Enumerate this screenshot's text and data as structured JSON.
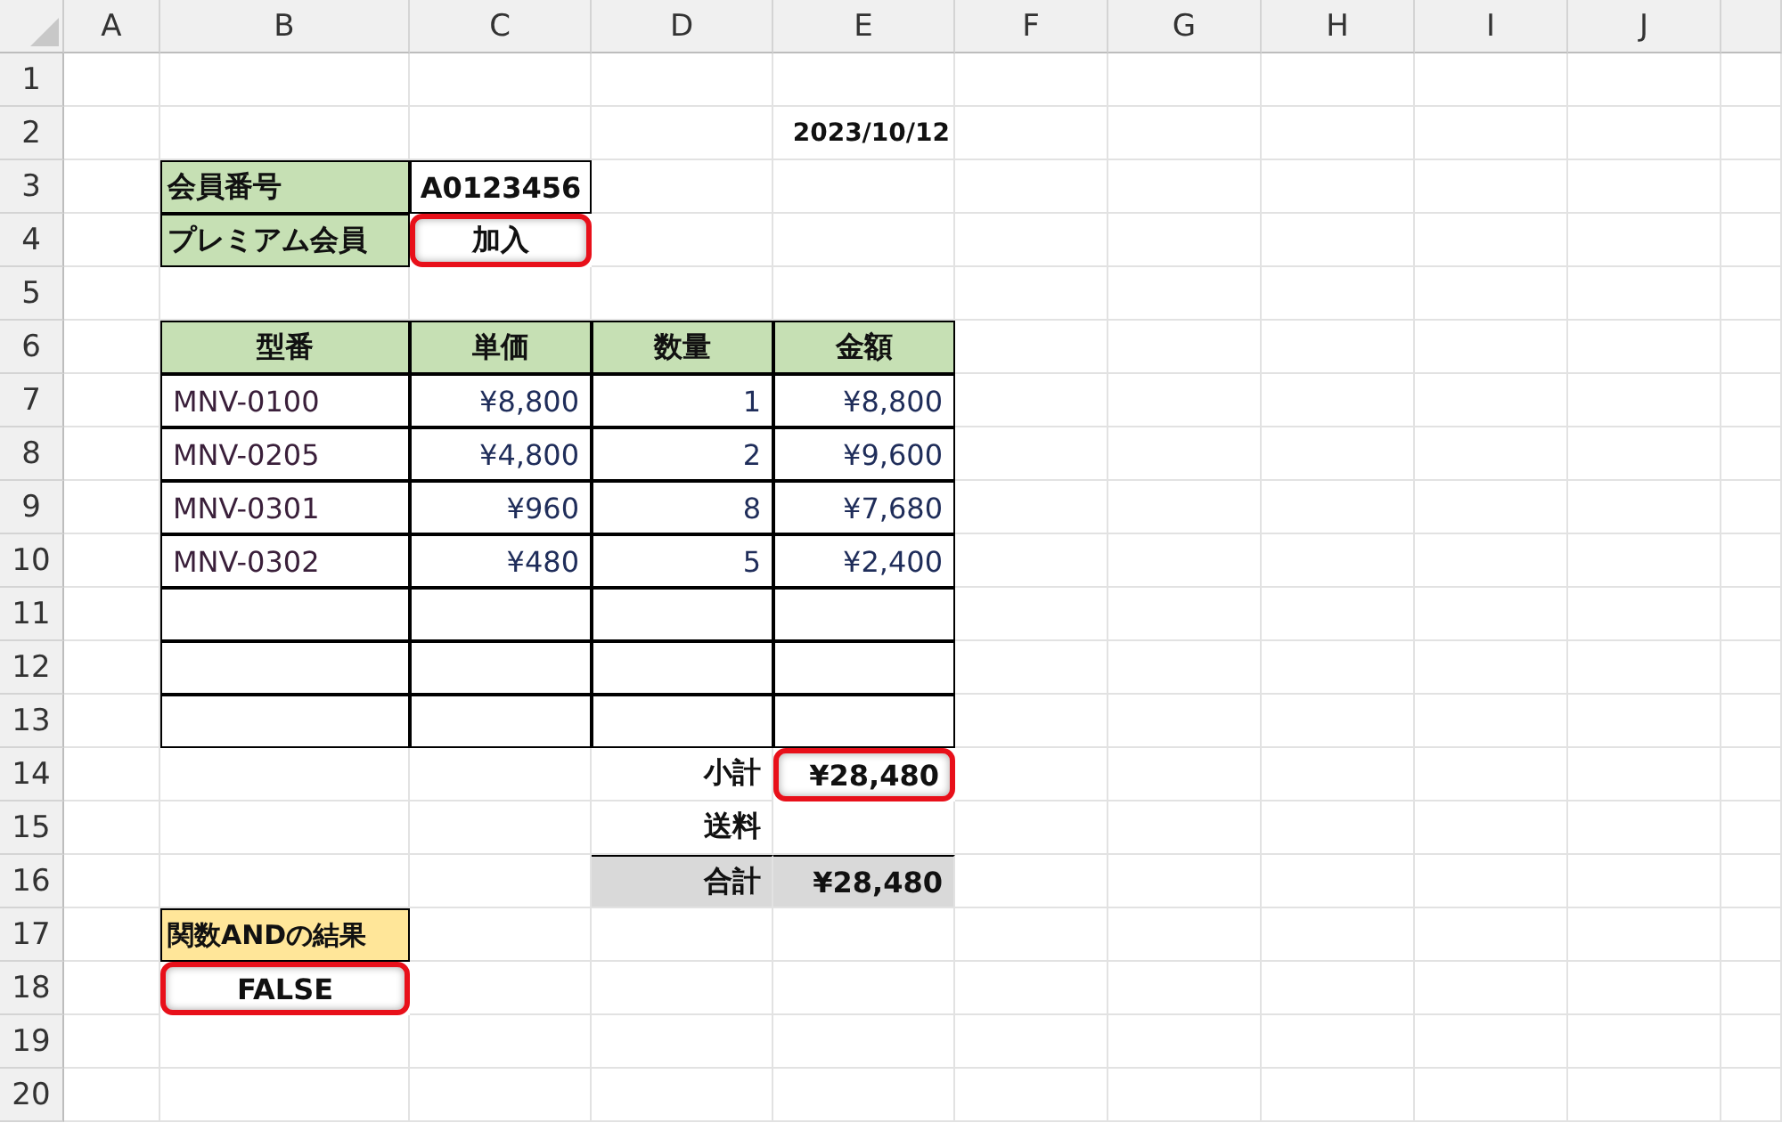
{
  "columns": [
    "A",
    "B",
    "C",
    "D",
    "E",
    "F",
    "G",
    "H",
    "I",
    "J"
  ],
  "row_numbers": [
    "1",
    "2",
    "3",
    "4",
    "5",
    "6",
    "7",
    "8",
    "9",
    "10",
    "11",
    "12",
    "13",
    "14",
    "15",
    "16",
    "17",
    "18",
    "19",
    "20"
  ],
  "date": "2023/10/12",
  "member": [
    {
      "label": "会員番号",
      "value": "A0123456",
      "highlighted": false
    },
    {
      "label": "プレミアム会員",
      "value": "加入",
      "highlighted": true
    }
  ],
  "items_table": {
    "columns": [
      "型番",
      "単価",
      "数量",
      "金額"
    ],
    "rows": [
      {
        "model": "MNV-0100",
        "unit_price": "¥8,800",
        "quantity": "1",
        "amount": "¥8,800"
      },
      {
        "model": "MNV-0205",
        "unit_price": "¥4,800",
        "quantity": "2",
        "amount": "¥9,600"
      },
      {
        "model": "MNV-0301",
        "unit_price": "¥960",
        "quantity": "8",
        "amount": "¥7,680"
      },
      {
        "model": "MNV-0302",
        "unit_price": "¥480",
        "quantity": "5",
        "amount": "¥2,400"
      }
    ]
  },
  "totals": [
    {
      "kind": "subtotal",
      "label": "小計",
      "value": "¥28,480",
      "highlighted": true
    },
    {
      "kind": "shipping",
      "label": "送料",
      "highlighted": false
    },
    {
      "kind": "total",
      "label": "合計",
      "value": "¥28,480",
      "highlighted": false
    }
  ],
  "result": {
    "label": "関数ANDの結果",
    "value": "FALSE",
    "highlighted": true
  }
}
